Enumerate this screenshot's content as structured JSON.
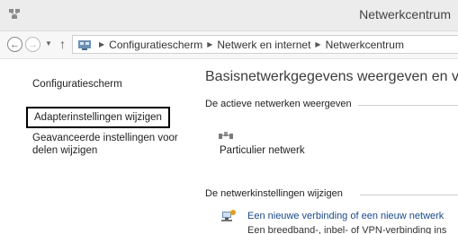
{
  "window": {
    "title": "Netwerkcentrum"
  },
  "nav": {
    "breadcrumb": [
      "Configuratiescherm",
      "Netwerk en internet",
      "Netwerkcentrum"
    ]
  },
  "sidebar": {
    "items": [
      {
        "label": "Configuratiescherm"
      },
      {
        "label": "Adapterinstellingen wijzigen"
      },
      {
        "label_line1": "Geavanceerde instellingen voor",
        "label_line2": "delen wijzigen"
      }
    ]
  },
  "main": {
    "heading": "Basisnetwerkgegevens weergeven en verb",
    "active_networks_label": "De actieve netwerken weergeven",
    "network_name": "Particulier netwerk",
    "settings_label": "De netwerkinstellingen wijzigen",
    "task_link": "Een nieuwe verbinding of een nieuw netwerk",
    "task_desc": "Een breedband-, inbel- of VPN-verbinding ins"
  },
  "icons": {
    "app": "network-center-icon",
    "back": "back-arrow-icon",
    "forward": "forward-arrow-icon",
    "recent": "chevron-down-icon",
    "up": "up-arrow-icon",
    "location": "control-panel-icon",
    "network": "network-icon",
    "new_connection": "new-connection-icon"
  }
}
